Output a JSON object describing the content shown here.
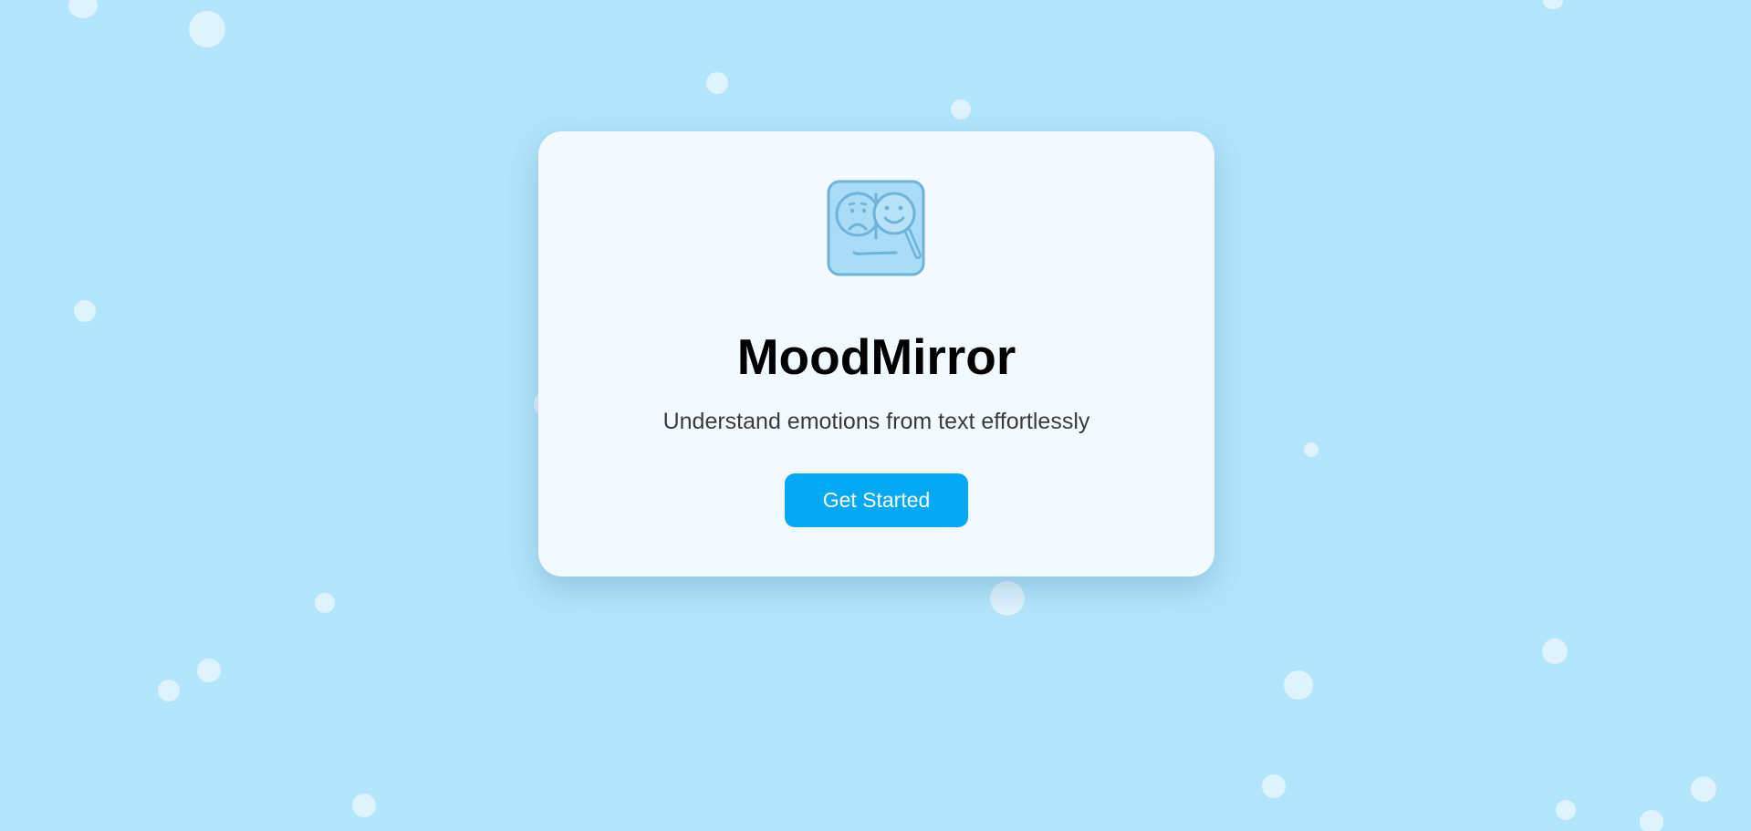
{
  "app": {
    "title": "MoodMirror",
    "tagline": "Understand emotions from text effortlessly"
  },
  "cta": {
    "label": "Get Started"
  },
  "logo": {
    "icon": "sad-happy-face-magnifier-icon"
  },
  "colors": {
    "background": "#b3e5fb",
    "card": "#f2faff",
    "button": "#03a9f4",
    "button_text": "#ffffff",
    "logo_fill": "#a8dcf7",
    "logo_stroke": "#6fb3d8"
  }
}
